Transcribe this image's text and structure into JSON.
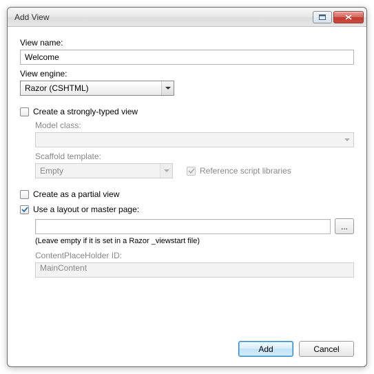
{
  "window": {
    "title": "Add View"
  },
  "labels": {
    "view_name": "View name:",
    "view_engine": "View engine:",
    "strongly_typed": "Create a strongly-typed view",
    "model_class": "Model class:",
    "scaffold_template": "Scaffold template:",
    "reference_libs": "Reference script libraries",
    "partial_view": "Create as a partial view",
    "use_layout": "Use a layout or master page:",
    "hint": "(Leave empty if it is set in a Razor _viewstart file)",
    "cph_id": "ContentPlaceHolder ID:"
  },
  "values": {
    "view_name": "Welcome",
    "view_engine": "Razor (CSHTML)",
    "model_class": "",
    "scaffold_template": "Empty",
    "layout_path": "",
    "cph_id": "MainContent",
    "browse": "..."
  },
  "checks": {
    "strongly_typed": false,
    "reference_libs": true,
    "partial_view": false,
    "use_layout": true
  },
  "buttons": {
    "add": "Add",
    "cancel": "Cancel"
  }
}
